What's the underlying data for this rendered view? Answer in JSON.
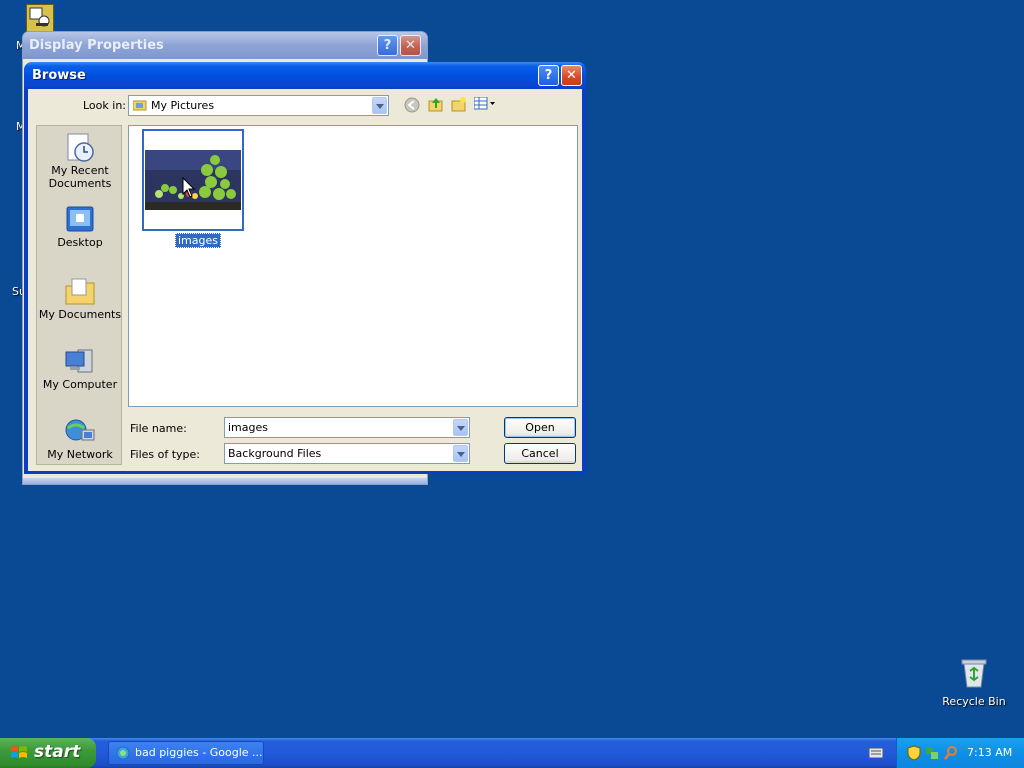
{
  "desktop": {
    "recycle_bin_label": "Recycle Bin",
    "partial_labels": [
      "M",
      "M",
      "Su"
    ]
  },
  "display_properties": {
    "title": "Display Properties"
  },
  "browse_dialog": {
    "title": "Browse",
    "look_in_label": "Look in:",
    "look_in_value": "My Pictures",
    "places": [
      {
        "label_line1": "My Recent",
        "label_line2": "Documents",
        "icon": "recent-documents-icon"
      },
      {
        "label_line1": "Desktop",
        "label_line2": "",
        "icon": "desktop-icon"
      },
      {
        "label_line1": "My Documents",
        "label_line2": "",
        "icon": "my-documents-icon"
      },
      {
        "label_line1": "My Computer",
        "label_line2": "",
        "icon": "my-computer-icon"
      },
      {
        "label_line1": "My Network",
        "label_line2": "",
        "icon": "my-network-icon"
      }
    ],
    "files": [
      {
        "name": "images",
        "selected": true
      }
    ],
    "file_name_label": "File name:",
    "file_name_value": "images",
    "file_type_label": "Files of type:",
    "file_type_value": "Background Files",
    "open_button": "Open",
    "cancel_button": "Cancel",
    "help_button": "?",
    "close_button": "✕"
  },
  "taskbar": {
    "start_label": "start",
    "task_item_label": "bad piggies - Google ...",
    "clock": "7:13 AM"
  },
  "colors": {
    "desktop": "#0a4a95",
    "titlebar": "#0050e0",
    "selection": "#316ac5"
  }
}
